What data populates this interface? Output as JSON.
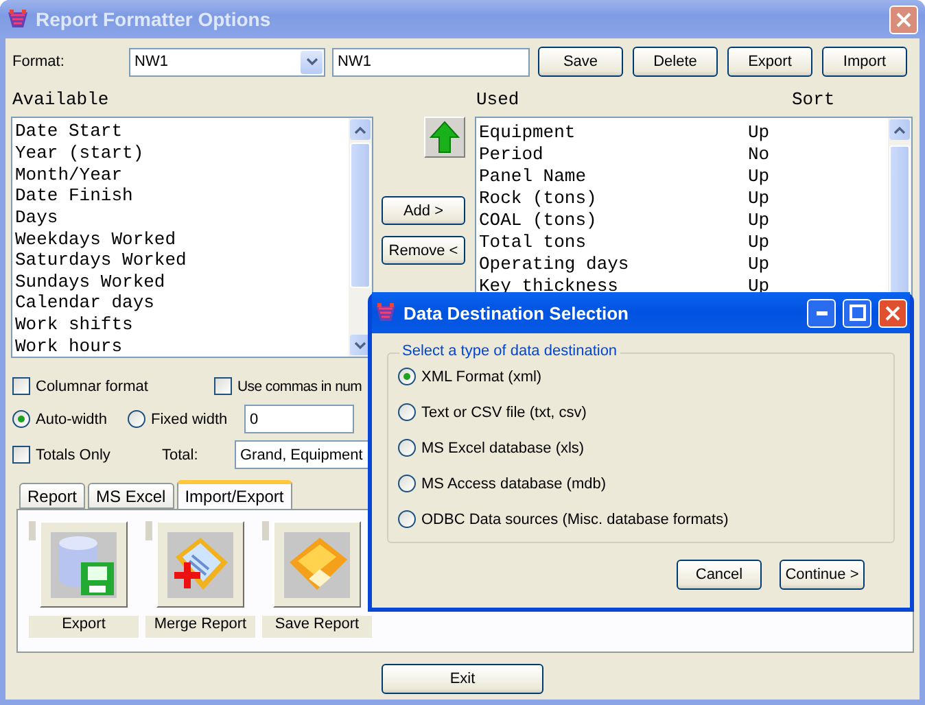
{
  "window": {
    "title": "Report Formatter Options"
  },
  "format": {
    "label": "Format:",
    "combo_value": "NW1",
    "name_value": "NW1"
  },
  "top_buttons": [
    "Save",
    "Delete",
    "Export",
    "Import"
  ],
  "available": {
    "heading": "Available",
    "items": [
      "Date Start",
      "Year (start)",
      "Month/Year",
      "Date Finish",
      "Days",
      "Weekdays Worked",
      "Saturdays Worked",
      "Sundays Worked",
      "Calendar days",
      "Work shifts",
      "Work hours"
    ]
  },
  "move_buttons": [
    "Add >",
    "Remove <"
  ],
  "used": {
    "heading": "Used",
    "sort_heading": "Sort",
    "rows": [
      {
        "name": "Equipment",
        "sort": "Up"
      },
      {
        "name": "Period",
        "sort": "No"
      },
      {
        "name": "Panel Name",
        "sort": "Up"
      },
      {
        "name": "Rock (tons)",
        "sort": "Up"
      },
      {
        "name": "COAL (tons)",
        "sort": "Up"
      },
      {
        "name": "Total tons",
        "sort": "Up"
      },
      {
        "name": "Operating days",
        "sort": "Up"
      },
      {
        "name": "Key thickness",
        "sort": "Up"
      }
    ]
  },
  "options": {
    "columnar": {
      "label": "Columnar format",
      "checked": false
    },
    "commas": {
      "label": "Use commas in num",
      "checked": false
    },
    "width_modes": [
      {
        "label": "Auto-width",
        "selected": true
      },
      {
        "label": "Fixed width",
        "selected": false
      }
    ],
    "fixed_width_value": "0",
    "totals_only": {
      "label": "Totals Only",
      "checked": false
    },
    "total": {
      "label": "Total:",
      "value": "Grand, Equipment"
    }
  },
  "tabs": [
    {
      "label": "Report",
      "selected": false
    },
    {
      "label": "MS Excel",
      "selected": false
    },
    {
      "label": "Import/Export",
      "selected": true
    }
  ],
  "tools": [
    {
      "kind": "export",
      "label": "Export"
    },
    {
      "kind": "merge",
      "label": "Merge Report"
    },
    {
      "kind": "save",
      "label": "Save Report"
    }
  ],
  "exit_button": "Exit",
  "dialog": {
    "title": "Data Destination Selection",
    "group_label": "Select a type of data destination",
    "options": [
      {
        "label": "XML Format (xml)",
        "selected": true
      },
      {
        "label": "Text or CSV file (txt, csv)",
        "selected": false
      },
      {
        "label": "MS Excel database (xls)",
        "selected": false
      },
      {
        "label": "MS Access database (mdb)",
        "selected": false
      },
      {
        "label": "ODBC Data sources (Misc. database formats)",
        "selected": false
      }
    ],
    "buttons": [
      "Cancel",
      "Continue >"
    ]
  }
}
